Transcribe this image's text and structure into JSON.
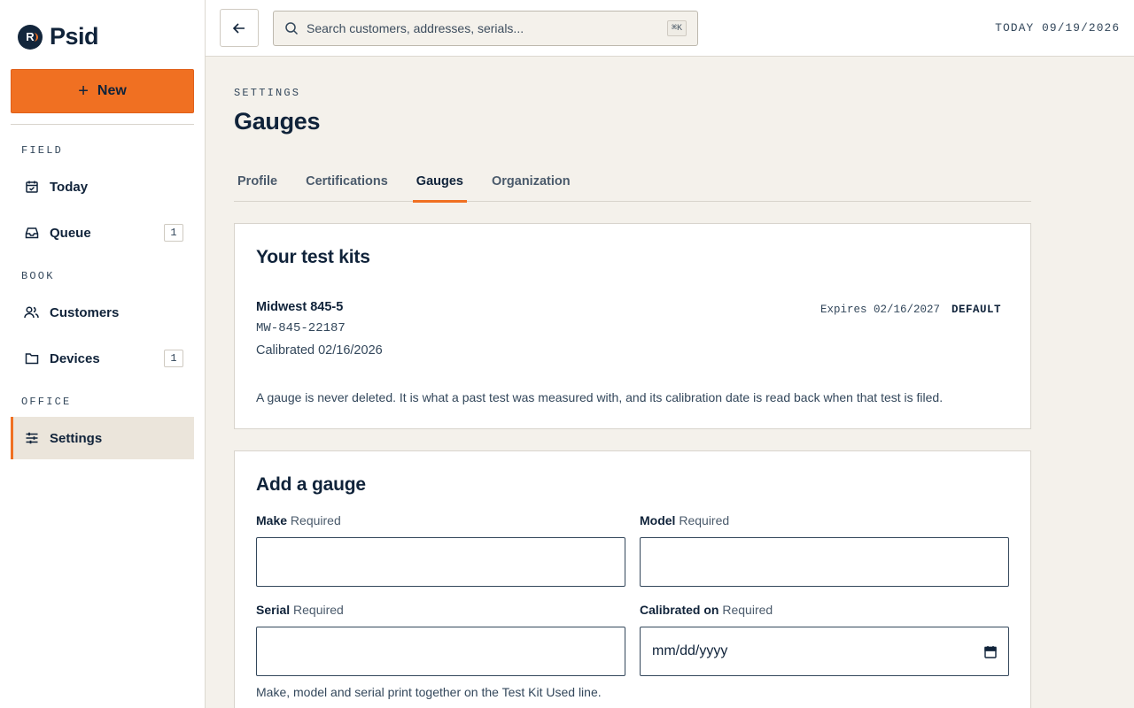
{
  "brand": {
    "name": "Psid",
    "logo_letter": "R"
  },
  "sidebar": {
    "new_button": "New",
    "sections": [
      {
        "label": "FIELD"
      },
      {
        "label": "BOOK"
      },
      {
        "label": "OFFICE"
      }
    ],
    "items": [
      {
        "label": "Today",
        "icon": "calendar-check-icon"
      },
      {
        "label": "Queue",
        "icon": "inbox-icon",
        "badge": "1"
      },
      {
        "label": "Customers",
        "icon": "users-icon"
      },
      {
        "label": "Devices",
        "icon": "folder-icon",
        "badge": "1"
      },
      {
        "label": "Settings",
        "icon": "sliders-icon",
        "active": true
      }
    ]
  },
  "topbar": {
    "search_placeholder": "Search customers, addresses, serials...",
    "shortcut": "⌘K",
    "today": "TODAY 09/19/2026"
  },
  "page": {
    "crumb": "SETTINGS",
    "title": "Gauges",
    "tabs": [
      {
        "label": "Profile"
      },
      {
        "label": "Certifications"
      },
      {
        "label": "Gauges",
        "active": true
      },
      {
        "label": "Organization"
      }
    ]
  },
  "test_kits": {
    "title": "Your test kits",
    "kits": [
      {
        "make_model": "Midwest 845-5",
        "serial": "MW-845-22187",
        "calibrated": "Calibrated 02/16/2026",
        "expires": "Expires 02/16/2027",
        "badge": "DEFAULT"
      }
    ],
    "note": "A gauge is never deleted. It is what a past test was measured with, and its calibration date is read back when that test is filed."
  },
  "add_gauge": {
    "title": "Add a gauge",
    "required_text": "Required",
    "make_label": "Make",
    "model_label": "Model",
    "serial_label": "Serial",
    "calibrated_label": "Calibrated on",
    "make_value": "",
    "model_value": "",
    "serial_value": "",
    "date_placeholder": "mm/dd/yyyy",
    "hint": "Make, model and serial print together on the Test Kit Used line."
  },
  "colors": {
    "accent": "#f07022",
    "ink": "#10233a",
    "canvas": "#f4f1eb"
  }
}
